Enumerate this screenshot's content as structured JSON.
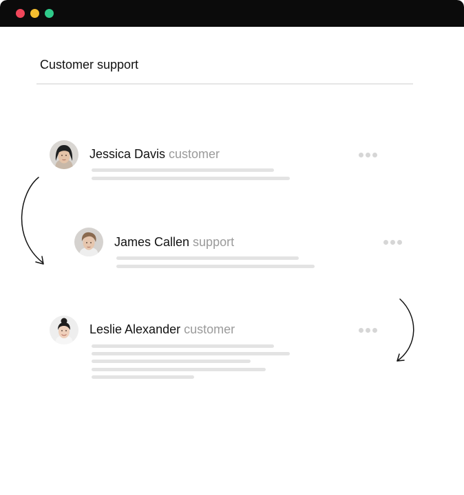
{
  "window": {
    "controls": [
      {
        "name": "close",
        "color": "#f0465a"
      },
      {
        "name": "minimize",
        "color": "#f5be2f"
      },
      {
        "name": "maximize",
        "color": "#2fca8a"
      }
    ]
  },
  "header": {
    "title": "Customer support"
  },
  "messages": [
    {
      "name": "Jessica Davis",
      "role": "customer",
      "avatar_icon": "avatar-jessica-davis",
      "more_icon": "more-dots-icon",
      "placeholder_lines": 2
    },
    {
      "name": "James Callen",
      "role": "support",
      "avatar_icon": "avatar-james-callen",
      "more_icon": "more-dots-icon",
      "placeholder_lines": 2
    },
    {
      "name": "Leslie Alexander",
      "role": "customer",
      "avatar_icon": "avatar-leslie-alexander",
      "more_icon": "more-dots-icon",
      "placeholder_lines": 5
    }
  ],
  "colors": {
    "titlebar": "#0b0b0b",
    "name_text": "#111111",
    "role_text": "#9a9a9a",
    "placeholder": "#e3e3e3",
    "more_dots": "#d6d6d6",
    "arrow": "#111111"
  }
}
